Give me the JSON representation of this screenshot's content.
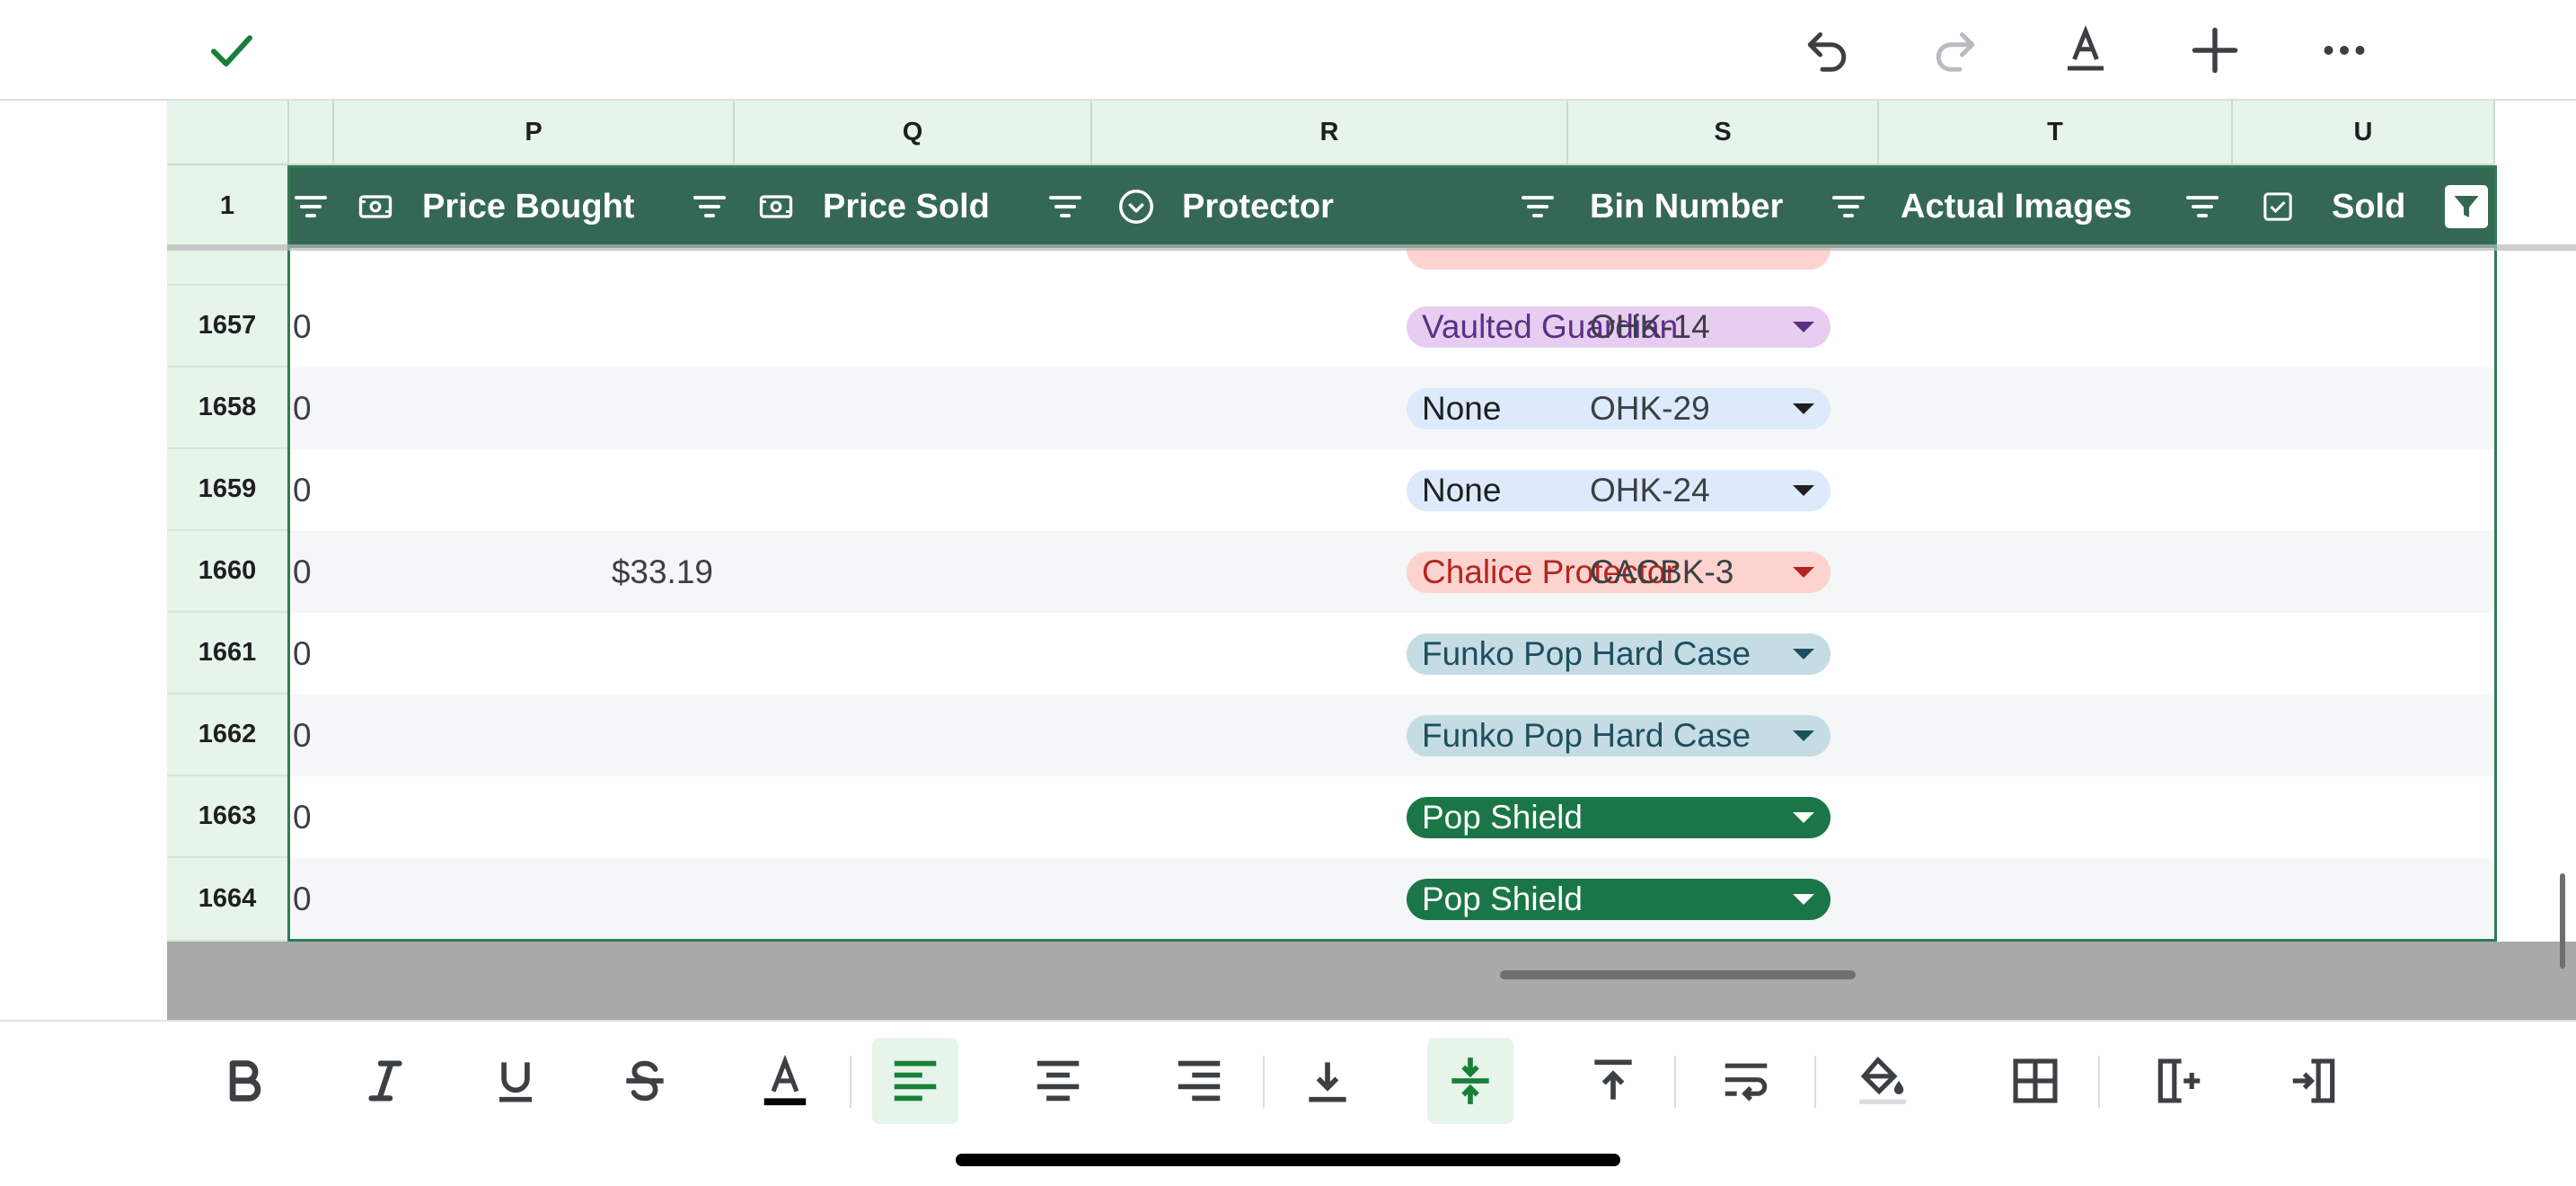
{
  "toolbar": {
    "confirm_icon": "check-icon",
    "undo_icon": "undo-icon",
    "redo_icon": "redo-icon",
    "text_format_icon": "text-format-icon",
    "insert_icon": "plus-icon",
    "more_icon": "more-icon"
  },
  "columns": [
    "P",
    "Q",
    "R",
    "S",
    "T",
    "U"
  ],
  "header_row_number": "1",
  "headers": {
    "price_bought": "Price Bought",
    "price_sold": "Price Sold",
    "protector": "Protector",
    "bin_number": "Bin Number",
    "actual_images": "Actual Images",
    "sold": "Sold"
  },
  "rows": [
    {
      "num": "1657",
      "left": "0",
      "price_bought": "",
      "protector": "Vaulted Guardian",
      "bin": "OHK-14"
    },
    {
      "num": "1658",
      "left": "0",
      "price_bought": "",
      "protector": "None",
      "bin": "OHK-29"
    },
    {
      "num": "1659",
      "left": "0",
      "price_bought": "",
      "protector": "None",
      "bin": "OHK-24"
    },
    {
      "num": "1660",
      "left": "0",
      "price_bought": "$33.19",
      "protector": "Chalice Protector",
      "bin": "CACBK-3"
    },
    {
      "num": "1661",
      "left": "0",
      "price_bought": "",
      "protector": "Funko Pop Hard Case",
      "bin": ""
    },
    {
      "num": "1662",
      "left": "0",
      "price_bought": "",
      "protector": "Funko Pop Hard Case",
      "bin": ""
    },
    {
      "num": "1663",
      "left": "0",
      "price_bought": "",
      "protector": "Pop Shield",
      "bin": ""
    },
    {
      "num": "1664",
      "left": "0",
      "price_bought": "",
      "protector": "Pop Shield",
      "bin": ""
    }
  ],
  "chip_colors": {
    "Vaulted Guardian": {
      "bg": "#e7cdf0",
      "fg": "#5b2f86"
    },
    "None": {
      "bg": "#dceafc",
      "fg": "#1f1f1f"
    },
    "Chalice Protector": {
      "bg": "#fdd3d0",
      "fg": "#b3261e"
    },
    "Funko Pop Hard Case": {
      "bg": "#c6dce4",
      "fg": "#1d4f5f"
    },
    "Pop Shield": {
      "bg": "#1a7646",
      "fg": "#ffffff"
    }
  },
  "accent_color": "#356853"
}
